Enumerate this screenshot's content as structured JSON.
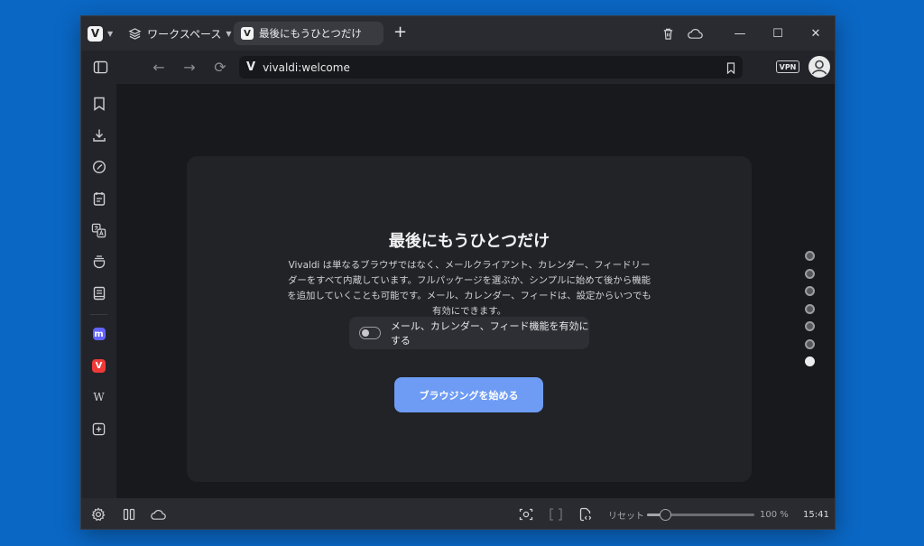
{
  "tabbar": {
    "logo_letter": "V",
    "workspace_label": "ワークスペース",
    "tab_title": "最後にもうひとつだけ",
    "new_tab_glyph": "+",
    "window_buttons": {
      "minimize": "—",
      "maximize": "☐",
      "close": "✕"
    }
  },
  "addressbar": {
    "url": "vivaldi:welcome",
    "vpn_label": "VPN"
  },
  "sidebar": {
    "items": [
      {
        "name": "bookmarks-icon"
      },
      {
        "name": "downloads-icon"
      },
      {
        "name": "history-icon"
      },
      {
        "name": "notes-icon"
      },
      {
        "name": "translate-icon"
      },
      {
        "name": "reading-list-icon"
      },
      {
        "name": "reader-icon"
      },
      {
        "name": "mastodon-icon"
      },
      {
        "name": "vivaldi-icon"
      },
      {
        "name": "wikipedia-icon"
      },
      {
        "name": "add-panel-icon"
      }
    ],
    "wikipedia_glyph": "W",
    "mastodon_glyph": "m"
  },
  "welcome": {
    "title": "最後にもうひとつだけ",
    "description": "Vivaldi は単なるブラウザではなく、メールクライアント、カレンダー、フィードリーダーをすべて内蔵しています。フルパッケージを選ぶか、シンプルに始めて後から機能を追加していくことも可能です。メール、カレンダー、フィードは、設定からいつでも有効にできます。",
    "toggle_label": "メール、カレンダー、フィード機能を有効にする",
    "toggle_on": false,
    "start_button": "ブラウジングを始める",
    "steps_total": 7,
    "active_step": 7
  },
  "statusbar": {
    "reset_label": "リセット",
    "zoom_value": 100,
    "zoom_label": "100 %",
    "clock": "15:41"
  },
  "colors": {
    "desktop": "#0a67c4",
    "accent": "#6e9cf5",
    "chrome": "#2a2b30",
    "content_bg": "#18191c",
    "card_bg": "#222327"
  }
}
